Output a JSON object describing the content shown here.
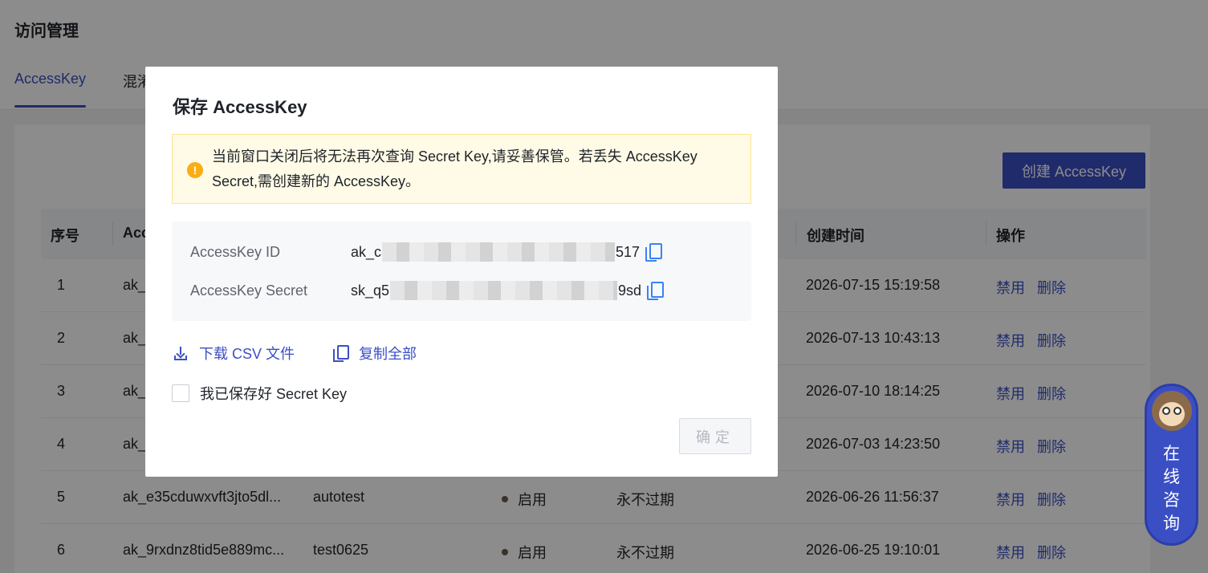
{
  "page": {
    "title": "访问管理"
  },
  "tabs": [
    {
      "label": "AccessKey",
      "active": true
    },
    {
      "label": "混淆",
      "active": false
    }
  ],
  "toolbar": {
    "create_label": "创建 AccessKey"
  },
  "table": {
    "headers": [
      "序号",
      "Acc",
      "创建时间",
      "操作"
    ],
    "rows": [
      {
        "index": "1",
        "key": "ak_",
        "name": "",
        "status": "",
        "expire": "",
        "created": "2026-07-15 15:19:58"
      },
      {
        "index": "2",
        "key": "ak_",
        "name": "",
        "status": "",
        "expire": "",
        "created": "2026-07-13 10:43:13"
      },
      {
        "index": "3",
        "key": "ak_",
        "name": "",
        "status": "",
        "expire": "",
        "created": "2026-07-10 18:14:25"
      },
      {
        "index": "4",
        "key": "ak_",
        "name": "",
        "status": "",
        "expire": "",
        "created": "2026-07-03 14:23:50"
      },
      {
        "index": "5",
        "key": "ak_e35cduwxvft3jto5dl...",
        "name": "autotest",
        "status": "启用",
        "expire": "永不过期",
        "created": "2026-06-26 11:56:37"
      },
      {
        "index": "6",
        "key": "ak_9rxdnz8tid5e889mc...",
        "name": "test0625",
        "status": "启用",
        "expire": "永不过期",
        "created": "2026-06-25 19:10:01"
      }
    ],
    "op_disable": "禁用",
    "op_delete": "删除"
  },
  "modal": {
    "title": "保存 AccessKey",
    "warning_icon": "!",
    "warning": "当前窗口关闭后将无法再次查询 Secret Key,请妥善保管。若丢失 AccessKey Secret,需创建新的 AccessKey。",
    "id_label": "AccessKey ID",
    "id_prefix": "ak_c",
    "id_suffix": "517",
    "secret_label": "AccessKey Secret",
    "secret_prefix": "sk_q5",
    "secret_suffix": "9sd",
    "download_label": "下载 CSV 文件",
    "copy_all_label": "复制全部",
    "confirm_label": "我已保存好 Secret Key",
    "ok_label": "确定"
  },
  "consult": {
    "label": "在线咨询"
  },
  "colors": {
    "primary": "#3b4fc4",
    "warning_bg": "#fffbe6",
    "warning_icon": "#faad14"
  }
}
